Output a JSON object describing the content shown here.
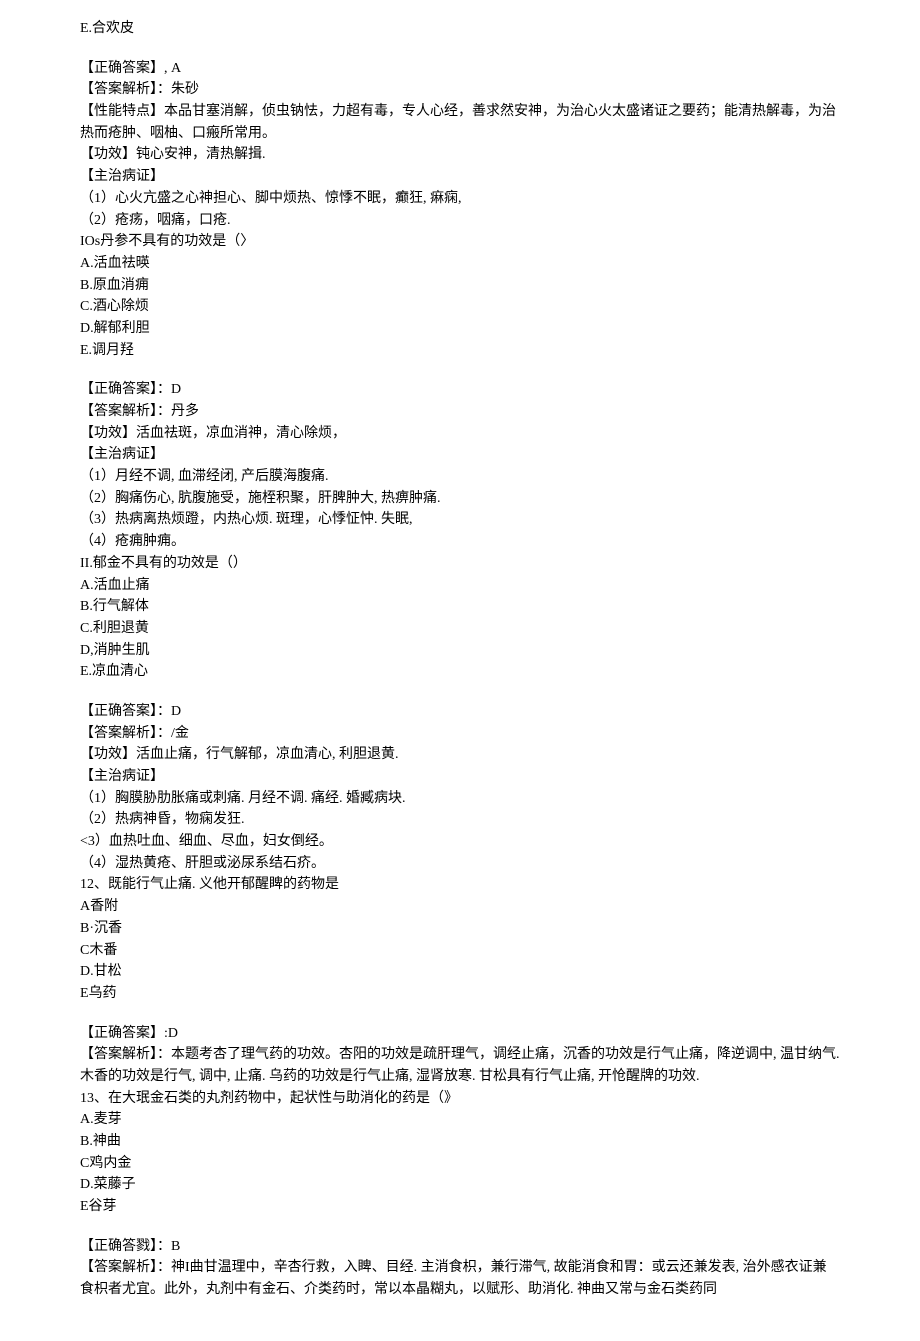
{
  "lines": [
    {
      "text": "E.合欢皮"
    },
    {
      "break": true
    },
    {
      "text": "【正确答案】, A"
    },
    {
      "text": "【答案解析】：朱砂"
    },
    {
      "text": "【性能特点】本品甘塞消解，侦虫钠怯，力超有毒，专人心经，善求然安神，为治心火太盛诸证之要药；能清热解毒，为治热而疮肿、咽柚、口瘢所常用。"
    },
    {
      "text": "【功效】钝心安神，清热解揖."
    },
    {
      "text": "【主治病证】"
    },
    {
      "text": "（1）心火亢盛之心神担心、脚中烦热、惊悸不眠，癫狂, 痳痫,"
    },
    {
      "text": "（2）疮疡，咽痛，口疮."
    },
    {
      "text": "IOs丹参不具有的功效是（〉"
    },
    {
      "text": "A.活血祛暎"
    },
    {
      "text": "B.原血消痈"
    },
    {
      "text": "C.酒心除烦"
    },
    {
      "text": "D.解郁利胆"
    },
    {
      "text": "E.调月羟"
    },
    {
      "break": true
    },
    {
      "text": "【正确答案】：D"
    },
    {
      "text": "【答案解析】：丹多"
    },
    {
      "text": "【功效】活血祛斑，凉血消神，清心除烦，"
    },
    {
      "text": "【主治病证】"
    },
    {
      "text": "（1）月经不调, 血滞经闭, 产后膜海腹痛."
    },
    {
      "text": "（2）胸痛伤心, 肮腹施受，施桎积聚，肝脾肿大, 热痹肿痛."
    },
    {
      "text": "（3）热病离热烦蹬，内热心烦. 斑理，心悸怔忡. 失眠,"
    },
    {
      "text": "（4）疮痈肿痈。"
    },
    {
      "text": "II.郁金不具有的功效是（）"
    },
    {
      "text": "A.活血止痛"
    },
    {
      "text": "B.行气解体"
    },
    {
      "text": "C.利胆退黄"
    },
    {
      "text": "D,消肿生肌"
    },
    {
      "text": "E.凉血清心"
    },
    {
      "break": true
    },
    {
      "text": "【正确答案】：D"
    },
    {
      "text": "【答案解析】：/金"
    },
    {
      "text": "【功效】活血止痛，行气解郁，凉血清心, 利胆退黄."
    },
    {
      "text": "【主治病证】"
    },
    {
      "text": "（1）胸膜胁肋胀痛或刺痛. 月经不调. 痛经. 婚臧病块."
    },
    {
      "text": "（2）热病神昏，物痫发狂."
    },
    {
      "text": "<3）血热吐血、细血、尽血，妇女倒经。"
    },
    {
      "text": "（4）湿热黄疮、肝胆或泌尿系结石疥。"
    },
    {
      "text": "12、既能行气止痛. 义他开郁醒睥的药物是"
    },
    {
      "text": "A香附"
    },
    {
      "text": "B·沉香"
    },
    {
      "text": "C木番"
    },
    {
      "text": "D.甘松"
    },
    {
      "text": "E乌药"
    },
    {
      "break": true
    },
    {
      "text": "【正确答案】:D"
    },
    {
      "text": "【答案解析】：本题考杏了理气药的功效。杏阳的功效是疏肝理气，调经止痛，沉香的功效是行气止痛，降逆调中, 温甘纳气. 木香的功效是行气, 调中, 止痛. 乌药的功效是行气止痛, 湿肾放寒. 甘松具有行气止痛, 开怆醒牌的功效."
    },
    {
      "text": "13、在大珉金石类的丸剂药物中，起状性与助消化的药是（》"
    },
    {
      "text": "A.麦芽"
    },
    {
      "text": "B.神曲"
    },
    {
      "text": "C鸡内金"
    },
    {
      "text": "D.菜藤子"
    },
    {
      "text": "E谷芽"
    },
    {
      "break": true
    },
    {
      "text": "【正确答戮】：B"
    },
    {
      "text": "【答案解析】：神I曲甘温理中，辛杏行救，入睥、目经. 主消食枳，兼行滞气, 故能消食和胃：或云还兼发表, 治外感衣证兼食枳者尤宜。此外，丸剂中有金石、介类药时，常以本晶糊丸，以赋形、助消化. 神曲又常与金石类药同"
    }
  ]
}
